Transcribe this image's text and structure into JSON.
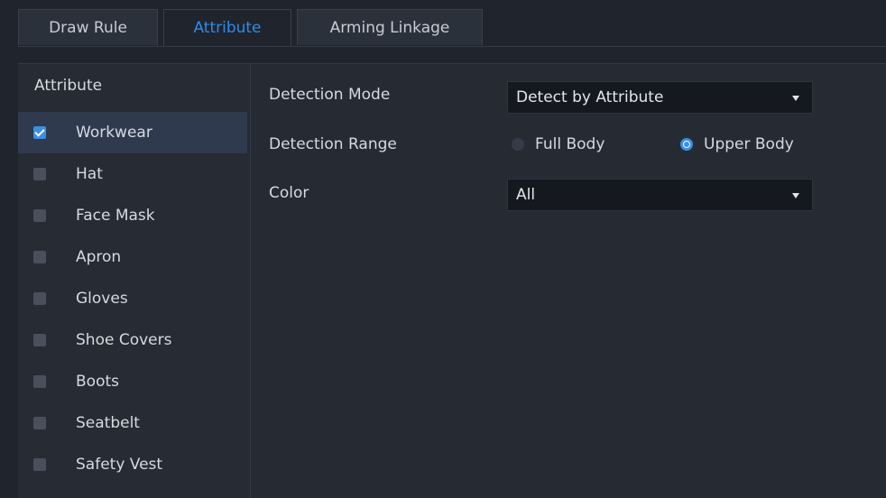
{
  "tabs": [
    {
      "label": "Draw Rule",
      "active": false
    },
    {
      "label": "Attribute",
      "active": true
    },
    {
      "label": "Arming Linkage",
      "active": false
    }
  ],
  "sidebar": {
    "title": "Attribute",
    "items": [
      {
        "label": "Workwear",
        "checked": true
      },
      {
        "label": "Hat",
        "checked": false
      },
      {
        "label": "Face Mask",
        "checked": false
      },
      {
        "label": "Apron",
        "checked": false
      },
      {
        "label": "Gloves",
        "checked": false
      },
      {
        "label": "Shoe Covers",
        "checked": false
      },
      {
        "label": "Boots",
        "checked": false
      },
      {
        "label": "Seatbelt",
        "checked": false
      },
      {
        "label": "Safety Vest",
        "checked": false
      }
    ]
  },
  "form": {
    "detection_mode": {
      "label": "Detection Mode",
      "value": "Detect by Attribute"
    },
    "detection_range": {
      "label": "Detection Range",
      "options": [
        {
          "label": "Full Body",
          "selected": false
        },
        {
          "label": "Upper Body",
          "selected": true
        }
      ]
    },
    "color": {
      "label": "Color",
      "value": "All"
    }
  },
  "colors": {
    "accent": "#2f8ce8",
    "background": "#1f242d",
    "selected_row": "#2f3a4f",
    "input_bg": "#15191f"
  }
}
